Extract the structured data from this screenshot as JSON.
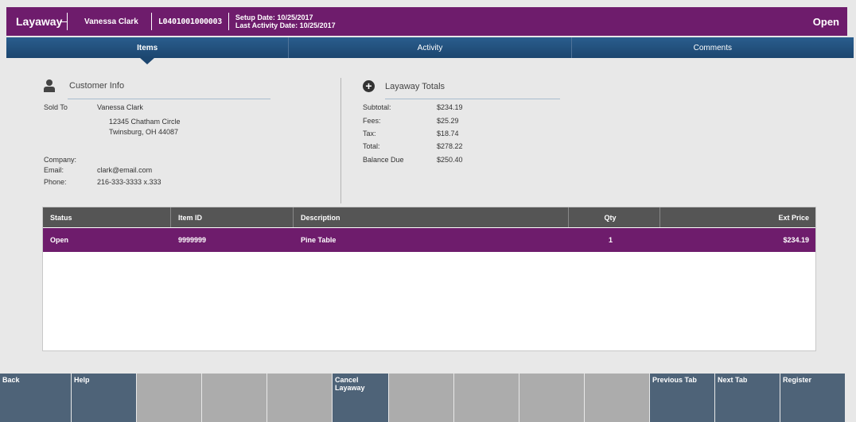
{
  "header": {
    "title": "Layaway",
    "customer_name": "Vanessa Clark",
    "layaway_id": "L0401001000003",
    "setup_date": "Setup Date: 10/25/2017",
    "last_activity_date": "Last Activity Date: 10/25/2017",
    "status": "Open"
  },
  "tabs": [
    {
      "label": "Items",
      "active": true
    },
    {
      "label": "Activity",
      "active": false
    },
    {
      "label": "Comments",
      "active": false
    }
  ],
  "customer_info": {
    "heading": "Customer Info",
    "sold_to_label": "Sold To",
    "name": "Vanessa Clark",
    "address1": "12345 Chatham Circle",
    "address2": "Twinsburg, OH 44087",
    "company_label": "Company:",
    "company": "",
    "email_label": "Email:",
    "email": "clark@email.com",
    "phone_label": "Phone:",
    "phone": "216-333-3333 x.333"
  },
  "totals": {
    "heading": "Layaway Totals",
    "subtotal_label": "Subtotal:",
    "subtotal": "$234.19",
    "fees_label": "Fees:",
    "fees": "$25.29",
    "tax_label": "Tax:",
    "tax": "$18.74",
    "total_label": "Total:",
    "total": "$278.22",
    "balance_label": "Balance Due",
    "balance": "$250.40"
  },
  "table": {
    "headers": [
      "Status",
      "Item ID",
      "Description",
      "Qty",
      "Ext Price"
    ],
    "rows": [
      [
        "Open",
        "9999999",
        "Pine Table",
        "1",
        "$234.19"
      ]
    ]
  },
  "function_keys": [
    {
      "label": "Back",
      "enabled": true
    },
    {
      "label": "Help",
      "enabled": true
    },
    {
      "label": "",
      "enabled": false
    },
    {
      "label": "",
      "enabled": false
    },
    {
      "label": "",
      "enabled": false
    },
    {
      "label": "Cancel Layaway",
      "enabled": true
    },
    {
      "label": "",
      "enabled": false
    },
    {
      "label": "",
      "enabled": false
    },
    {
      "label": "",
      "enabled": false
    },
    {
      "label": "",
      "enabled": false
    },
    {
      "label": "Previous Tab",
      "enabled": true
    },
    {
      "label": "Next Tab",
      "enabled": true
    },
    {
      "label": "Register",
      "enabled": true
    }
  ],
  "colors": {
    "header_bg": "#6e1c6c",
    "tab_bg": "#1f4e7a",
    "selected_row_bg": "#6e1c6c",
    "fkey_enabled": "#4e6378",
    "fkey_disabled": "#acacac"
  }
}
